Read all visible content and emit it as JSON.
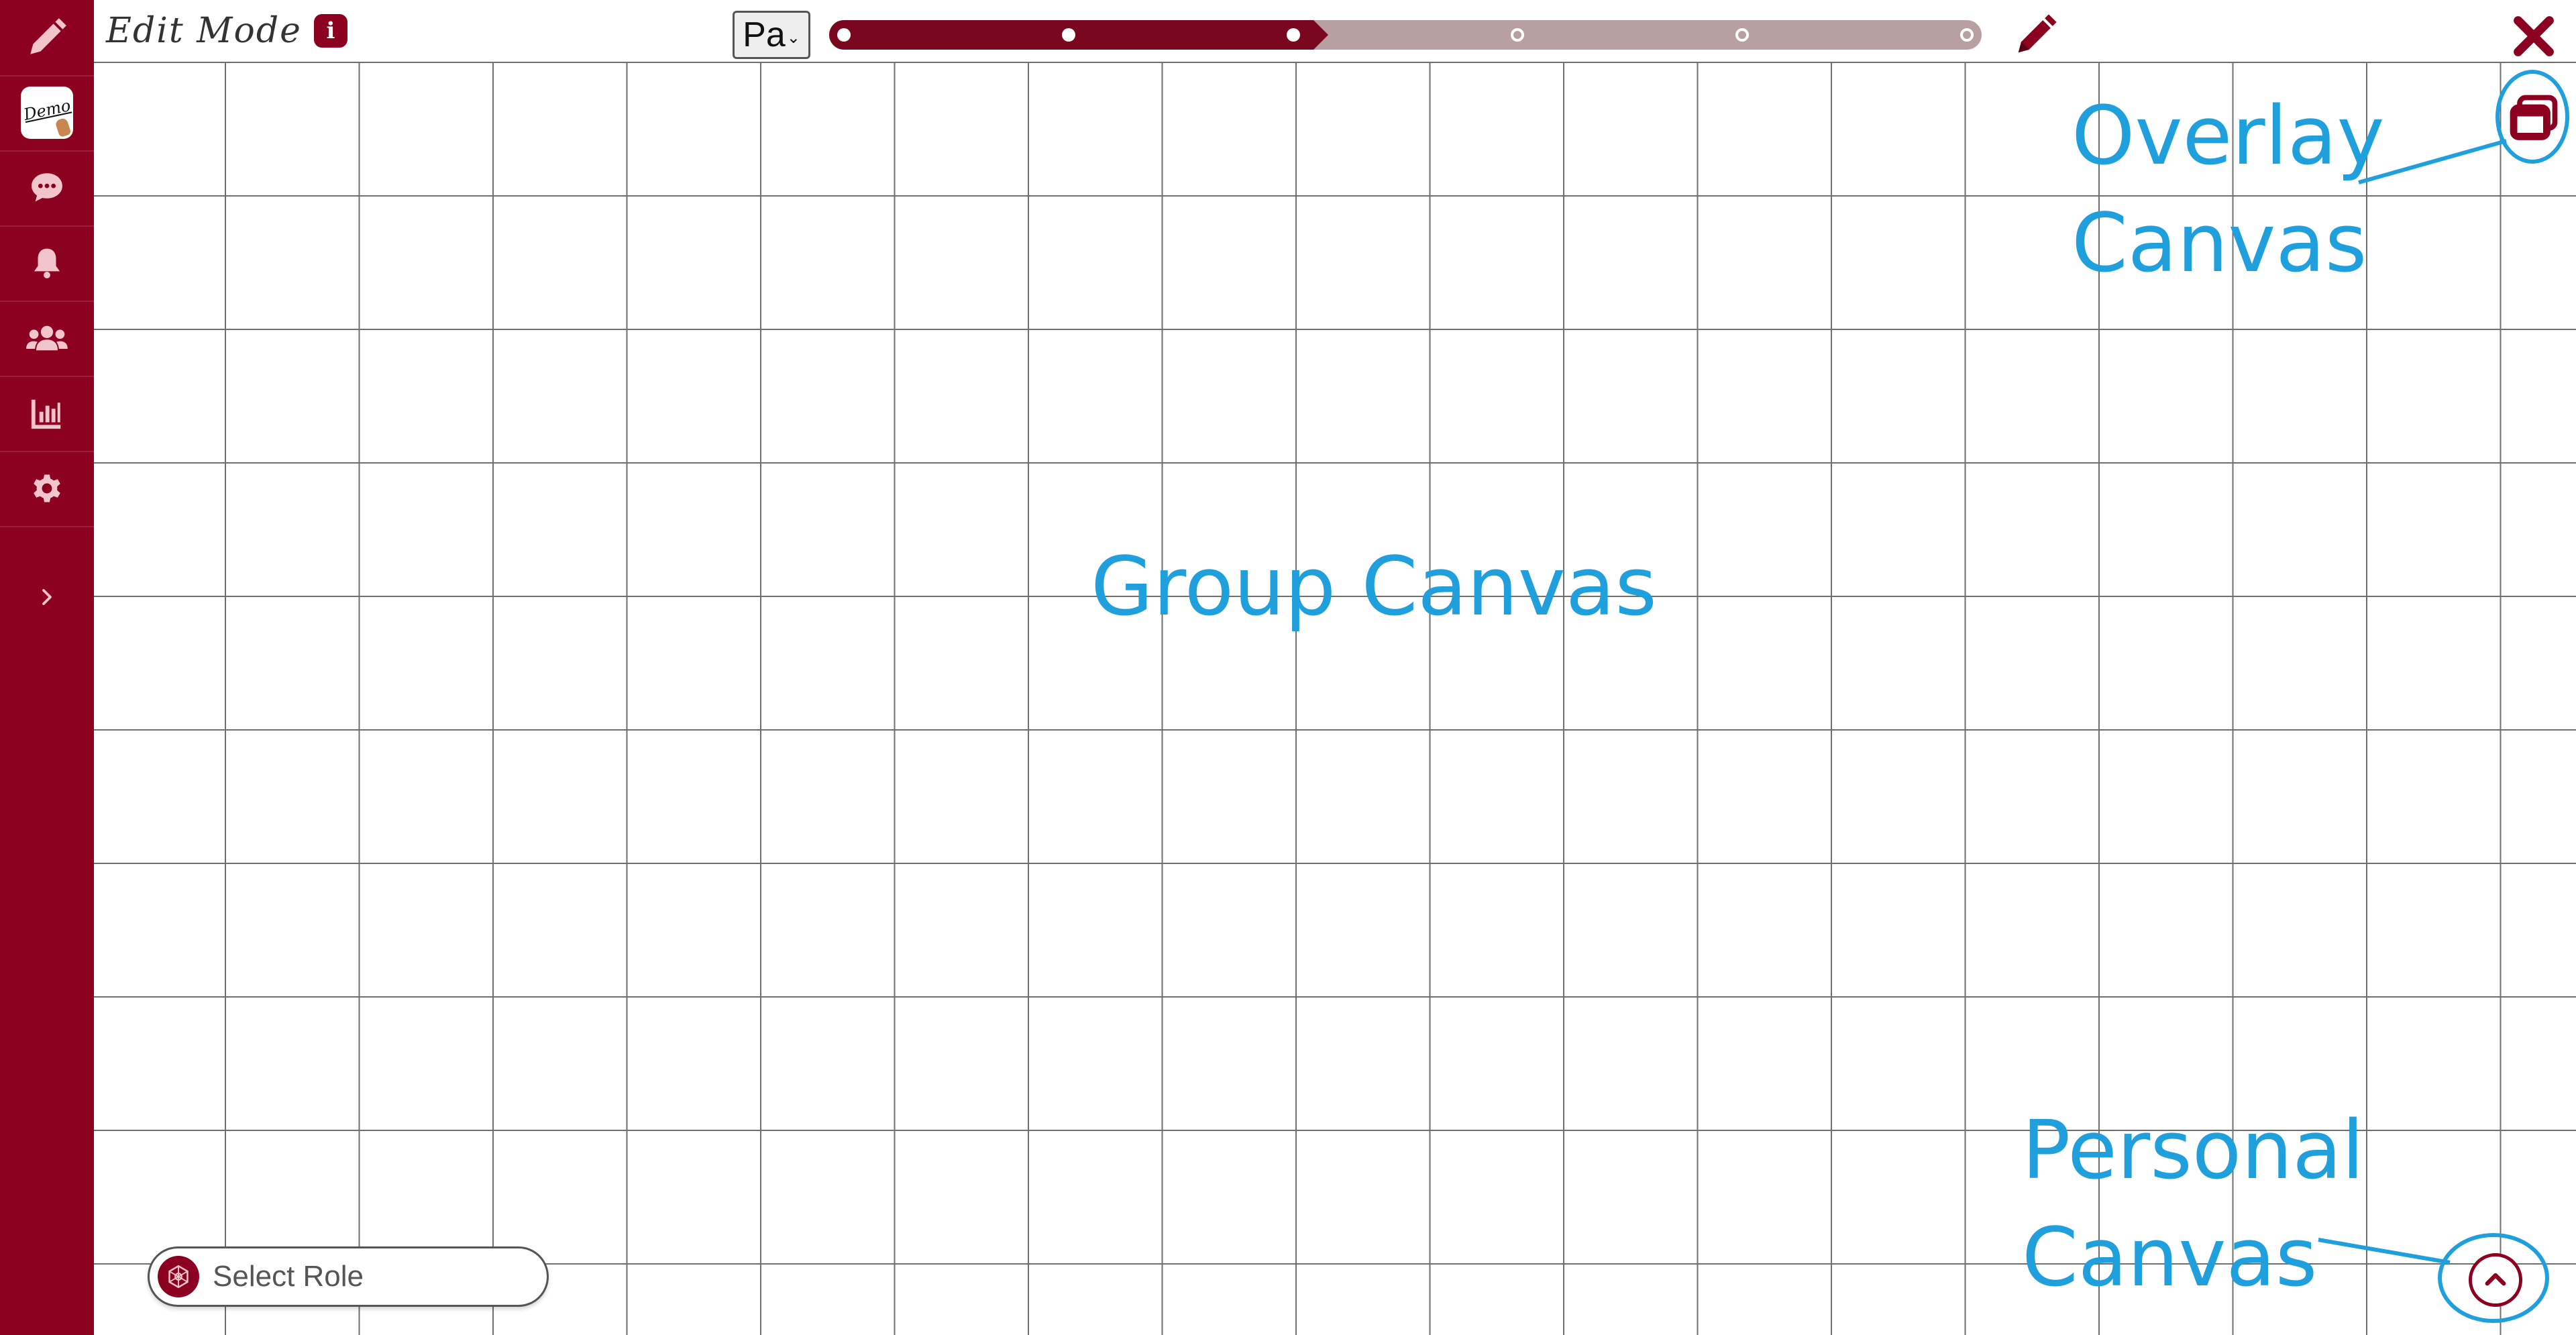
{
  "sidebar": {
    "items": [
      {
        "icon": "pencil-icon",
        "name": "sidebar-item-edit"
      },
      {
        "icon": "app-logo",
        "name": "sidebar-item-app",
        "tile_text": "Demo"
      },
      {
        "icon": "chat-icon",
        "name": "sidebar-item-chat"
      },
      {
        "icon": "bell-icon",
        "name": "sidebar-item-notifications"
      },
      {
        "icon": "users-icon",
        "name": "sidebar-item-users"
      },
      {
        "icon": "chart-icon",
        "name": "sidebar-item-analytics"
      },
      {
        "icon": "gear-icon",
        "name": "sidebar-item-settings"
      }
    ],
    "expand_icon": "chevron-right-icon"
  },
  "header": {
    "mode_label": "Edit Mode",
    "info_icon": "i",
    "page_select_value": "Pa",
    "progress": {
      "steps_total": 6,
      "steps_completed": 3,
      "fraction_complete": 0.42
    },
    "edit_icon": "pencil-icon",
    "close_icon": "close-icon"
  },
  "overlay_button_icon": "window-stack-icon",
  "annotations": {
    "overlay_line1": "Overlay",
    "overlay_line2": "Canvas",
    "group": "Group Canvas",
    "personal_line1": "Personal",
    "personal_line2": "Canvas"
  },
  "role_select": {
    "placeholder": "Select Role",
    "icon": "role-icon"
  },
  "personal_button_icon": "chevron-up-icon",
  "colors": {
    "brand": "#8c0020",
    "progress_fill": "#7a0720",
    "progress_track": "#b8a0a2",
    "annotation": "#1fa0dc",
    "grid": "#6f6f6f"
  }
}
